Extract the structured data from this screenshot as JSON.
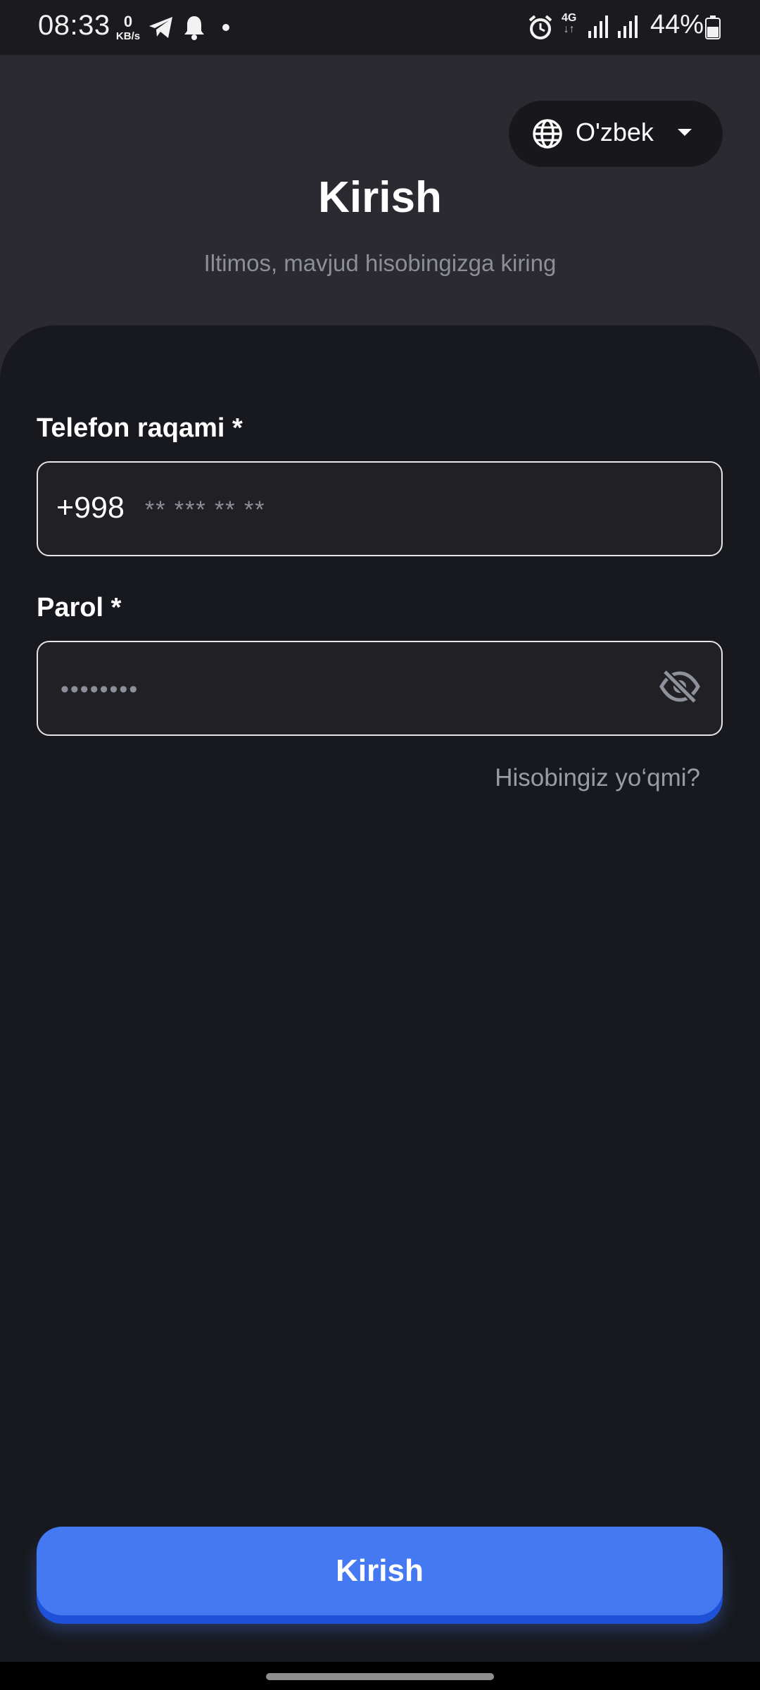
{
  "status_bar": {
    "time": "08:33",
    "net_speed_value": "0",
    "net_speed_unit": "KB/s",
    "network_type": "4G",
    "battery": "44%"
  },
  "header": {
    "language": "O'zbek",
    "title": "Kirish",
    "subtitle": "Iltimos, mavjud hisobingizga kiring"
  },
  "form": {
    "phone": {
      "label": "Telefon raqami *",
      "prefix": "+998",
      "placeholder": "** *** ** **",
      "value": ""
    },
    "password": {
      "label": "Parol *",
      "placeholder": "••••••••",
      "value": ""
    },
    "register_link": "Hisobingiz yo‘qmi?"
  },
  "submit_label": "Kirish",
  "colors": {
    "accent": "#4479f2",
    "background": "#18191e",
    "header_background": "#2a2a30"
  },
  "icons": {
    "language": "globe-icon",
    "dropdown": "caret-down-icon",
    "password_toggle": "eye-off-icon"
  }
}
